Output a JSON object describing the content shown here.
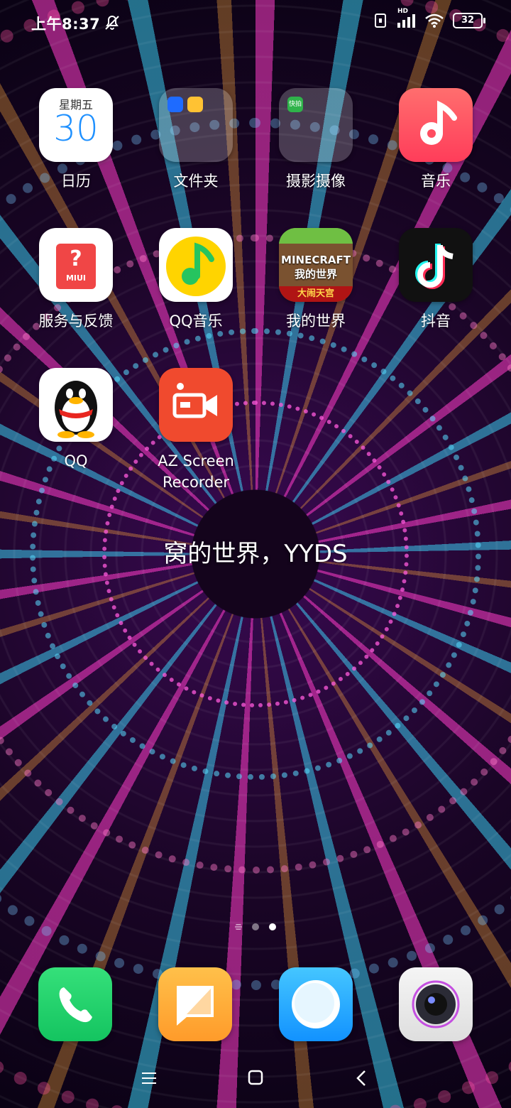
{
  "status_bar": {
    "time": "上午8:37",
    "battery": "32",
    "network_badge": "HD"
  },
  "apps": [
    {
      "label": "日历",
      "calendar_weekday": "星期五",
      "calendar_day": "30"
    },
    {
      "label": "文件夹"
    },
    {
      "label": "摄影摄像",
      "folder_badge": "快拍"
    },
    {
      "label": "音乐"
    },
    {
      "label": "服务与反馈",
      "badge_text": "MIUI"
    },
    {
      "label": "QQ音乐"
    },
    {
      "label": "我的世界",
      "logo_text": "MINECRAFT 我的世界",
      "banner_text": "大闹天宫"
    },
    {
      "label": "抖音"
    },
    {
      "label": "QQ"
    },
    {
      "label": "AZ Screen Recorder"
    }
  ],
  "widget": {
    "text": "窝的世界，YYDS"
  },
  "page_indicator": {
    "pages": 3,
    "active_index": 2
  },
  "dock": [
    "phone-icon",
    "messages-icon",
    "browser-icon",
    "camera-icon"
  ],
  "colors": {
    "accent_blue": "#1e90ff",
    "music_red": "#ff3d5a",
    "az_orange": "#f04a2e"
  }
}
